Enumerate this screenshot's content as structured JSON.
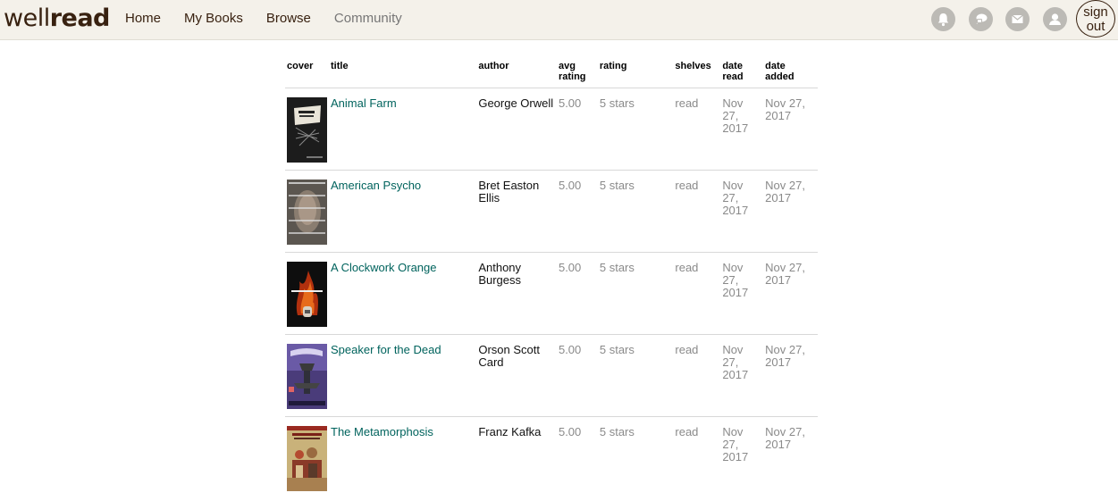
{
  "brand": {
    "light": "well",
    "bold": "read"
  },
  "nav": [
    {
      "label": "Home"
    },
    {
      "label": "My Books"
    },
    {
      "label": "Browse"
    },
    {
      "label": "Community"
    }
  ],
  "header_icons": [
    "notifications-icon",
    "friend-requests-icon",
    "messages-icon",
    "profile-icon"
  ],
  "signout": {
    "line1": "sign",
    "line2": "out"
  },
  "table": {
    "columns": [
      "cover",
      "title",
      "author",
      "avg\nrating",
      "rating",
      "shelves",
      "date\nread",
      "date added"
    ],
    "rows": [
      {
        "title": "Animal Farm",
        "author": "George Orwell",
        "avg_rating": "5.00",
        "rating": "5 stars",
        "shelves": "read",
        "date_read": "Nov 27, 2017",
        "date_added": "Nov 27, 2017"
      },
      {
        "title": "American Psycho",
        "author": "Bret Easton Ellis",
        "avg_rating": "5.00",
        "rating": "5 stars",
        "shelves": "read",
        "date_read": "Nov 27, 2017",
        "date_added": "Nov 27, 2017"
      },
      {
        "title": "A Clockwork Orange",
        "author": "Anthony Burgess",
        "avg_rating": "5.00",
        "rating": "5 stars",
        "shelves": "read",
        "date_read": "Nov 27, 2017",
        "date_added": "Nov 27, 2017"
      },
      {
        "title": "Speaker for the Dead",
        "author": "Orson Scott Card",
        "avg_rating": "5.00",
        "rating": "5 stars",
        "shelves": "read",
        "date_read": "Nov 27, 2017",
        "date_added": "Nov 27, 2017"
      },
      {
        "title": "The Metamorphosis",
        "author": "Franz Kafka",
        "avg_rating": "5.00",
        "rating": "5 stars",
        "shelves": "read",
        "date_read": "Nov 27, 2017",
        "date_added": "Nov 27, 2017"
      }
    ]
  },
  "colors": {
    "header_bg": "#f4f1ea",
    "brand": "#382110",
    "link": "#00635d",
    "muted_text": "#8a8a8a"
  }
}
